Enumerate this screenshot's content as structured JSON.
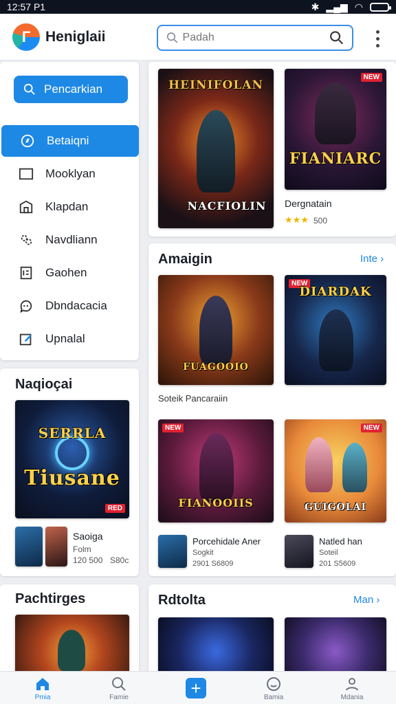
{
  "status_bar": {
    "time": "12:57",
    "carrier": "P1",
    "signal_text": ""
  },
  "app": {
    "title": "Heniglaii"
  },
  "search": {
    "placeholder": "Padah"
  },
  "sidebar": {
    "search_button_label": "Pencarkian",
    "items": [
      {
        "label": "Betaiqni",
        "icon": "compass-icon",
        "active": true
      },
      {
        "label": "Mooklyan",
        "icon": "window-icon",
        "active": false
      },
      {
        "label": "Klapdan",
        "icon": "building-icon",
        "active": false
      },
      {
        "label": "Navdliann",
        "icon": "people-icon",
        "active": false
      },
      {
        "label": "Gaohen",
        "icon": "document-icon",
        "active": false
      },
      {
        "label": "Dbndacacia",
        "icon": "chat-icon",
        "active": false
      },
      {
        "label": "Upnalal",
        "icon": "edit-icon",
        "active": false
      }
    ]
  },
  "left_sections": [
    {
      "title": "Naqioçai",
      "cover_text": "Tiusane",
      "cover_top": "SERRLA",
      "mini_title": "Saoiga",
      "mini_sub": "Folm",
      "mini_meta": "120 500",
      "mini_price": "S80c"
    },
    {
      "title": "Pachtirges"
    }
  ],
  "featured": {
    "left_cover_text": "HEINIFOLAN",
    "left_cover_bottom": "NACFIOLIN",
    "right_cover_text": "FIANIARC",
    "right_title": "Dergnatain",
    "right_price": "500"
  },
  "section2": {
    "title": "Amaigin",
    "more": "Inte",
    "cover1": "FUAGOOIO",
    "cover2": "DIARDAK",
    "caption": "Soteik Pancaraiin",
    "cover3": "FIANOOIIS",
    "cover4": "GUIGOLAI",
    "item1_title": "Porcehidale Aner",
    "item1_sub": "Sogkit",
    "item1_meta": "2901  S6809",
    "item2_title": "Natled han",
    "item2_sub": "Soteil",
    "item2_meta": "201  S5609"
  },
  "section3": {
    "title": "Rdtolta",
    "more": "Man"
  },
  "bottom_nav": [
    {
      "label": "Pmia",
      "icon": "home-icon",
      "active": true
    },
    {
      "label": "Famie",
      "icon": "search-person-icon",
      "active": false
    },
    {
      "label": "",
      "icon": "plus-icon",
      "active": false
    },
    {
      "label": "Bamia",
      "icon": "smile-icon",
      "active": false
    },
    {
      "label": "Mdania",
      "icon": "user-icon",
      "active": false
    }
  ]
}
